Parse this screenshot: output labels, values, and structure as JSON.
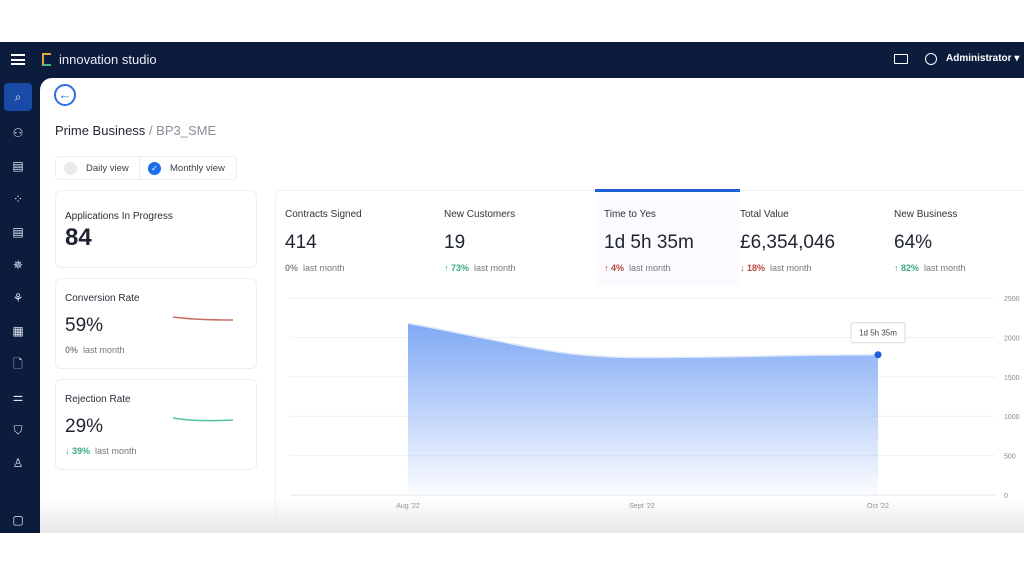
{
  "header": {
    "brand": "innovation studio",
    "user": "Administrator"
  },
  "sidebar": {
    "icons": [
      "search-icon",
      "apps-icon",
      "clipboard-icon",
      "grid-dots-icon",
      "checklist-icon",
      "helm-icon",
      "network-icon",
      "table-icon",
      "document-code-icon",
      "sliders-icon",
      "shield-check-icon",
      "user-check-icon",
      "chat-icon"
    ]
  },
  "breadcrumb": {
    "root": "Prime Business",
    "current": "/ BP3_SME"
  },
  "view_toggle": {
    "daily": "Daily view",
    "monthly": "Monthly view",
    "selected": "Monthly view"
  },
  "left_cards": [
    {
      "title": "Applications In Progress",
      "value": "84"
    },
    {
      "title": "Conversion Rate",
      "value": "59%",
      "change": "0%",
      "change_label": "last month",
      "trend_color": "#c96a63"
    },
    {
      "title": "Rejection Rate",
      "value": "29%",
      "change": "↓ 39%",
      "change_label": "last month",
      "trend_color": "#4ec3a8"
    }
  ],
  "kpis": [
    {
      "title": "Contracts Signed",
      "value": "414",
      "change": "0%",
      "label": "last month"
    },
    {
      "title": "New Customers",
      "value": "19",
      "change": "↑ 73%",
      "label": "last month"
    },
    {
      "title": "Time to Yes",
      "value": "1d 5h 35m",
      "change": "↑ 4%",
      "label": "last month",
      "selected": true
    },
    {
      "title": "Total Value",
      "value": "£6,354,046",
      "change": "↓ 18%",
      "label": "last month"
    },
    {
      "title": "New Business",
      "value": "64%",
      "change": "↑ 82%",
      "label": "last month"
    }
  ],
  "chart_data": {
    "type": "area",
    "categories": [
      "Aug '22",
      "Sept '22",
      "Oct '22"
    ],
    "values": [
      2180,
      1745,
      1780
    ],
    "ylim": [
      0,
      2500
    ],
    "yticks": [
      "0",
      "500",
      "1000",
      "1500",
      "2000",
      "2500"
    ],
    "grid": true,
    "tooltip": "1d 5h 35m",
    "color": "#7fa9f5"
  }
}
